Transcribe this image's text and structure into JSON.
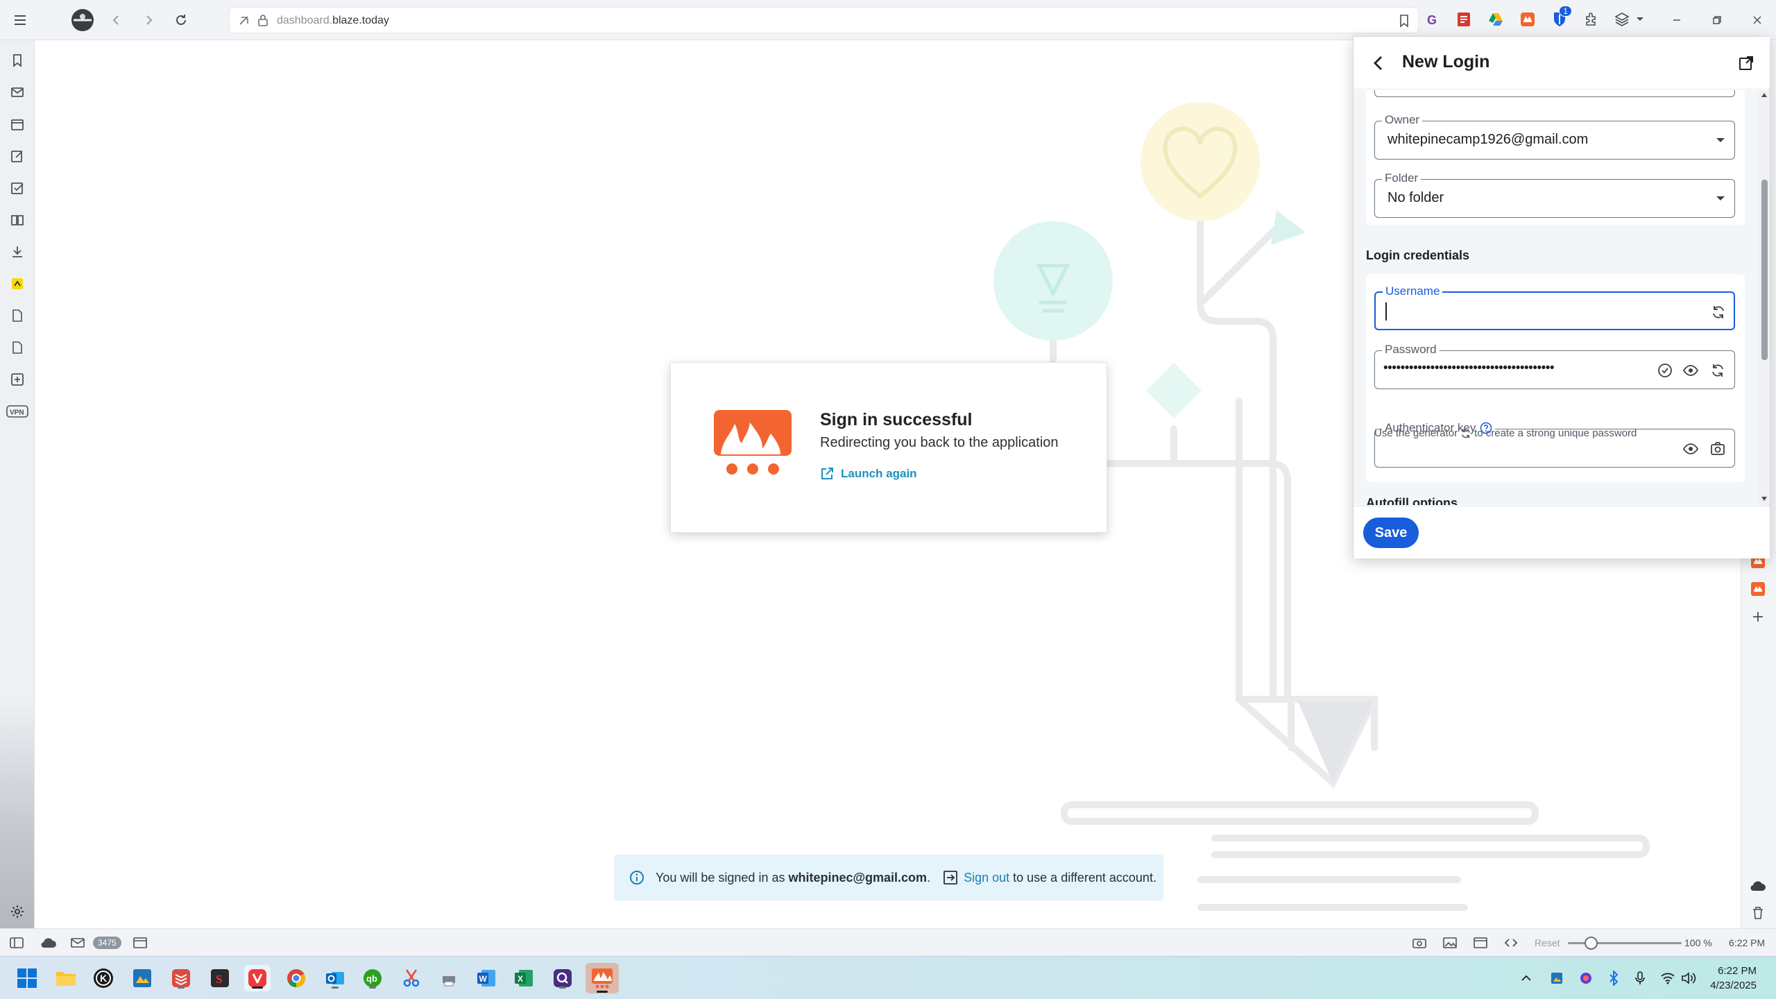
{
  "browser": {
    "url_prefix": "dashboard.",
    "url_domain": "blaze.today",
    "extension_badge": "1"
  },
  "signin_card": {
    "title": "Sign in successful",
    "subtitle": "Redirecting you back to the application",
    "launch_label": "Launch again"
  },
  "banner": {
    "prefix": "You will be signed in as ",
    "email": "whitepinec@gmail.com",
    "period": ".",
    "signout_label": "Sign out",
    "suffix": " to use a different account."
  },
  "bitwarden": {
    "title": "New Login",
    "owner": {
      "label": "Owner",
      "value": "whitepinecamp1926@gmail.com"
    },
    "folder": {
      "label": "Folder",
      "value": "No folder"
    },
    "section_credentials": "Login credentials",
    "username": {
      "label": "Username",
      "value": ""
    },
    "password": {
      "label": "Password",
      "value": "••••••••••••••••••••••••••••••••••••••••"
    },
    "hint_before": "Use the generator",
    "hint_after": "to create a strong unique password",
    "authenticator": {
      "label": "Authenticator key",
      "value": ""
    },
    "section_autofill": "Autofill options",
    "save_label": "Save"
  },
  "statusbar": {
    "mail_count": "3475",
    "reset_label": "Reset",
    "zoom_level": "100 %",
    "time": "6:22 PM"
  },
  "taskbar": {
    "time": "6:22 PM",
    "date": "4/23/2025"
  },
  "colors": {
    "brand_blue": "#175ddc",
    "blaze_orange": "#f26531",
    "banner_bg": "#e5f3fa"
  },
  "icons": [
    "menu-icon",
    "back-icon",
    "forward-icon",
    "reload-icon",
    "lock-icon",
    "bookmark-icon",
    "search-icon",
    "gear-icon",
    "eye-icon",
    "refresh-icon",
    "camera-icon",
    "help-icon",
    "external-link-icon",
    "info-icon",
    "sign-out-icon",
    "check-circle-icon"
  ]
}
